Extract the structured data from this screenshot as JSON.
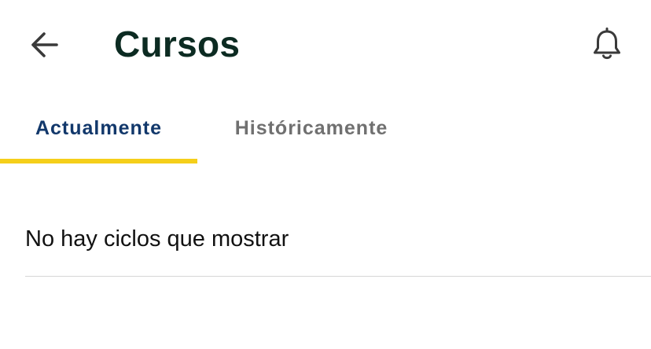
{
  "header": {
    "title": "Cursos",
    "back_icon": "arrow-left-icon",
    "notification_icon": "bell-icon"
  },
  "tabs": [
    {
      "label": "Actualmente",
      "selected": true
    },
    {
      "label": "Históricamente",
      "selected": false
    }
  ],
  "content": {
    "empty_message": "No hay ciclos que mostrar"
  },
  "colors": {
    "title": "#0c2b22",
    "tab_active": "#12386b",
    "tab_inactive": "#707070",
    "indicator": "#f5cf1a",
    "divider": "#d6d6d6"
  }
}
